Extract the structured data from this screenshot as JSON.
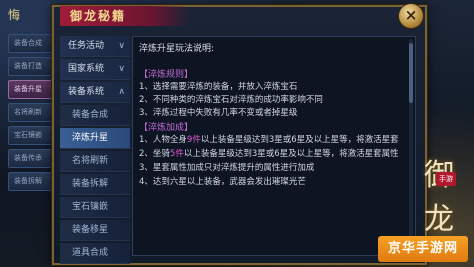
{
  "background": {
    "top_label": "悔",
    "items": [
      "装备合成",
      "装备打造",
      "装备升星",
      "名将刷新",
      "宝石镶嵌",
      "装备传承",
      "装备拆解"
    ],
    "active_index": 2
  },
  "panel": {
    "title": "御龙秘籍",
    "close": "×"
  },
  "nav": [
    {
      "label": "任务活动",
      "type": "header",
      "chevron": "∨"
    },
    {
      "label": "国家系统",
      "type": "header",
      "chevron": "∨"
    },
    {
      "label": "装备系统",
      "type": "header",
      "chevron": "∧"
    },
    {
      "label": "装备合成",
      "type": "sub"
    },
    {
      "label": "淬炼升星",
      "type": "sub",
      "active": true
    },
    {
      "label": "名将刷新",
      "type": "sub"
    },
    {
      "label": "装备拆解",
      "type": "sub"
    },
    {
      "label": "宝石镶嵌",
      "type": "sub"
    },
    {
      "label": "装备移星",
      "type": "sub"
    },
    {
      "label": "道具合成",
      "type": "sub"
    }
  ],
  "content": {
    "title": "淬炼升星玩法说明:",
    "rules_tag": "【淬炼规则】",
    "rules": [
      "1、选择需要淬炼的装备，并放入淬炼宝石",
      "2、不同种类的淬炼宝石对淬炼的成功率影响不同",
      "3、淬炼过程中失败有几率不变或者掉星级"
    ],
    "bonus_tag": "【淬炼加成】",
    "bonus": [
      {
        "pre": "1、人物全身",
        "hl": "9件",
        "post": "以上装备星级达到3星或6星及以上星等，将激活星套"
      },
      {
        "pre": "2、坐骑",
        "hl": "5件",
        "post": "以上装备星级达到3星或6星及以上星等，将激活星套属性"
      },
      {
        "pre": "3、星套属性加成只对淬炼提升的属性进行加成",
        "hl": "",
        "post": ""
      },
      {
        "pre": "4、达到六星以上装备，武器会发出璀璨光芒",
        "hl": "",
        "post": ""
      }
    ]
  },
  "decoration": {
    "logo_text": "御龙",
    "logo_tag": "手游",
    "watermark": "京华手游网"
  },
  "colors": {
    "accent_gold": "#7b6334",
    "highlight": "#e05ad6",
    "section_tag": "#c46ad6",
    "active_nav": "#3a5f95"
  }
}
